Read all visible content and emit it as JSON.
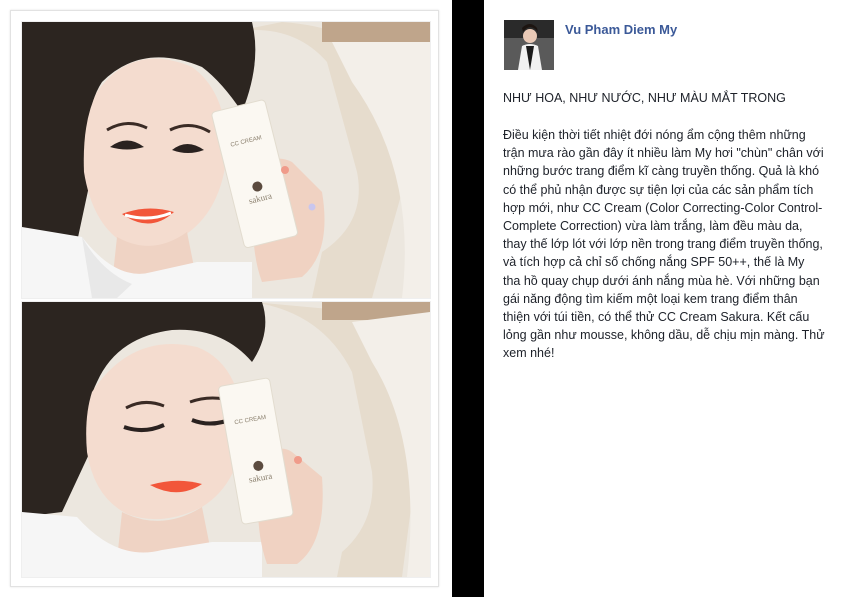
{
  "post": {
    "author": "Vu Pham Diem My",
    "title": "NHƯ HOA, NHƯ NƯỚC, NHƯ MÀU MẮT TRONG",
    "body": "Điều kiện thời tiết nhiệt đới nóng ẩm cộng thêm những trận mưa rào gần đây ít nhiều làm My hơi \"chùn\" chân với những bước trang điểm kĩ càng truyền thống. Quả là khó có thể phủ nhận được sự tiện lợi của các sản phẩm tích hợp mới, như CC Cream (Color Correcting-Color Control- Complete Correction) vừa làm trắng, làm đều màu da, thay thế lớp lót với lớp nền trong trang điểm truyền thống, và tích hợp cả chỉ số chống nắng SPF 50++, thế là My tha hồ quay chụp dưới ánh nắng mùa hè. Với những bạn gái năng động tìm kiếm một loại kem trang điểm thân thiện với túi tiền, có thể thử CC Cream Sakura. Kết cấu lỏng gần như mousse, không dầu, dễ chịu mịn màng. Thử xem nhé!"
  },
  "photo": {
    "product_label_top": "CC CREAM",
    "brand": "sakura"
  },
  "colors": {
    "link_blue": "#3b5998",
    "text": "#1d2129",
    "separator": "#000000",
    "lip_orange": "#f2563a"
  }
}
